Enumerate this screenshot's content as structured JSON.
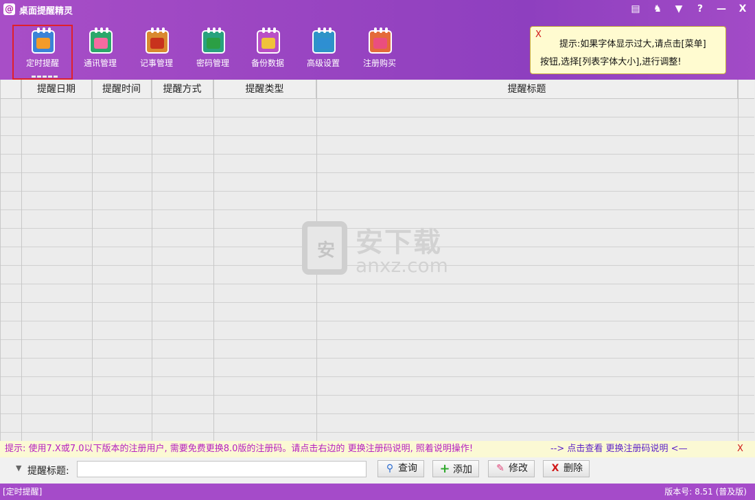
{
  "window": {
    "title": "桌面提醒精灵",
    "logo_glyph": "@",
    "controls": [
      "calendar-icon",
      "shirt-icon",
      "menu-icon",
      "help-icon",
      "minimize-icon",
      "close-icon"
    ],
    "control_glyphs": [
      "▤",
      "♞",
      "▼",
      "?",
      "—",
      "X"
    ]
  },
  "toolbar": {
    "items": [
      {
        "label": "定时提醒",
        "icon": "alarm-clock-icon",
        "color": "#3b83d8",
        "inner": "#f39b2a"
      },
      {
        "label": "通讯管理",
        "icon": "contacts-icon",
        "color": "#2aa86a",
        "inner": "#f56aa0"
      },
      {
        "label": "记事管理",
        "icon": "notepad-icon",
        "color": "#d9892f",
        "inner": "#c8321d"
      },
      {
        "label": "密码管理",
        "icon": "password-icon",
        "color": "#29a27e",
        "inner": "#2b9f44"
      },
      {
        "label": "备份数据",
        "icon": "backup-icon",
        "color": "#b94fc6",
        "inner": "#f0c23a"
      },
      {
        "label": "高级设置",
        "icon": "settings-icon",
        "color": "#2e93c8",
        "inner": "#2e8fd2"
      },
      {
        "label": "注册购买",
        "icon": "register-icon",
        "color": "#e46a3a",
        "inner": "#ea4e7f"
      }
    ]
  },
  "hint": {
    "close_glyph": "X",
    "line1": "提示:如果字体显示过大,请点击[菜单]",
    "line2": "按钮,选择[列表字体大小],进行调整!"
  },
  "table": {
    "columns": [
      "提醒日期",
      "提醒时间",
      "提醒方式",
      "提醒类型",
      "提醒标题"
    ],
    "rows": []
  },
  "watermark": {
    "badge": "安",
    "big": "安下载",
    "small": "anxz.com"
  },
  "notice": {
    "text": "提示: 使用7.X或7.0以下版本的注册用户, 需要免费更换8.0版的注册码。请点击右边的 更换注册码说明, 照着说明操作!",
    "link": "--> 点击查看 更换注册码说明 <—",
    "close_glyph": "X"
  },
  "search": {
    "label": "提醒标题:",
    "value": "",
    "buttons": [
      {
        "label": "查询",
        "icon": "search-icon",
        "glyph": "🔍",
        "color": "#2a6bd0"
      },
      {
        "label": "添加",
        "icon": "add-icon",
        "glyph": "+",
        "color": "#2fa82c"
      },
      {
        "label": "修改",
        "icon": "edit-icon",
        "glyph": "✎",
        "color": "#e0457a"
      },
      {
        "label": "删除",
        "icon": "delete-icon",
        "glyph": "X",
        "color": "#d01818"
      }
    ]
  },
  "status": {
    "left": "[定时提醒]",
    "right": "版本号: 8.51 (普及版)"
  }
}
